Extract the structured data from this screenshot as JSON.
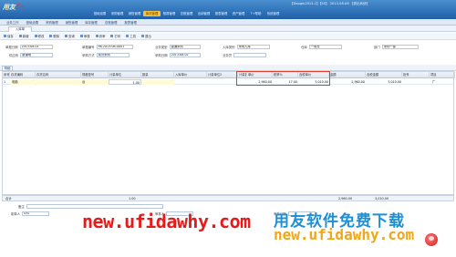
{
  "app": {
    "logo_text": "用友",
    "logo_brand": "T+",
    "status": "【Daogin2013-1】【SS】 2013-08-06 【退出系统】",
    "colors": {
      "header_top": "#4a8fd0",
      "header_bottom": "#1f5fa8",
      "menu_active": "#f3c33f",
      "highlight": "#e43b2a"
    }
  },
  "menu": [
    "基础设置",
    "采购管理",
    "销售管理",
    "库存管理",
    "核算管理",
    "总账管理",
    "出纳管理",
    "报表管理",
    "资产管理",
    "T+帮助",
    "系统管理"
  ],
  "nav_tabs": [
    "业务工作",
    "基础设置",
    "采购管理",
    "销售管理",
    "库存管理",
    "总账管理",
    "报表管理"
  ],
  "doc_tab": "入库单",
  "toolbar": [
    "保存",
    "新增",
    "修改",
    "删除",
    "查询",
    "审核",
    "弃审",
    "打印",
    "工具",
    "退出"
  ],
  "form": {
    "row1": [
      {
        "label": "单据日期",
        "value": "2013-08-01"
      },
      {
        "label": "单据编号",
        "value": "RK-2013-08-0001"
      },
      {
        "label": "业务类型",
        "value": "普通采购"
      },
      {
        "label": "入库类别",
        "value": "采购入库"
      },
      {
        "label": "仓库",
        "value": "一般仓"
      },
      {
        "label": "部门",
        "value": "采购一部"
      }
    ],
    "row2": [
      {
        "label": "供应商",
        "value": "新疆地"
      },
      {
        "label": "采购方式",
        "value": "现货采购"
      },
      {
        "label": "采购日期",
        "value": "2013-08-01"
      },
      {
        "label": "业务员",
        "value": ""
      }
    ]
  },
  "grid_tab": "明细",
  "grid": {
    "headers": [
      "序号",
      "存货编码",
      "存货名称",
      "规格型号",
      "计量单位",
      "数量",
      "入库单价",
      "计量单位2",
      "计量数量2",
      "单价",
      "税率%",
      "含税单价",
      "金额",
      "含税金额",
      "批号",
      "项目"
    ],
    "row": {
      "no": "1",
      "name": "电脑",
      "unit": "台",
      "qty": "1.00",
      "price": "2,960.00",
      "tax_rate": "17.00",
      "tax_price": "3,010.00",
      "amount": "2,960.00",
      "tax_amount": "3,010.00",
      "batch": "",
      "project": "广"
    }
  },
  "totals": {
    "label": "合计",
    "qty": "1.00",
    "amount": "2,960.00",
    "tax_amount": "3,010.00"
  },
  "footer": {
    "row1": [
      {
        "label": "备注",
        "value": ""
      }
    ],
    "row2": [
      {
        "label": "制单人",
        "value": "SYS"
      },
      {
        "label": "审核人",
        "value": ""
      },
      {
        "label": "审核日期",
        "value": ""
      }
    ]
  },
  "watermark": {
    "left_url": "new.ufidawhy.com",
    "right_cn": "用友软件免费下载",
    "right_url": "new.ufidawhy.com"
  }
}
